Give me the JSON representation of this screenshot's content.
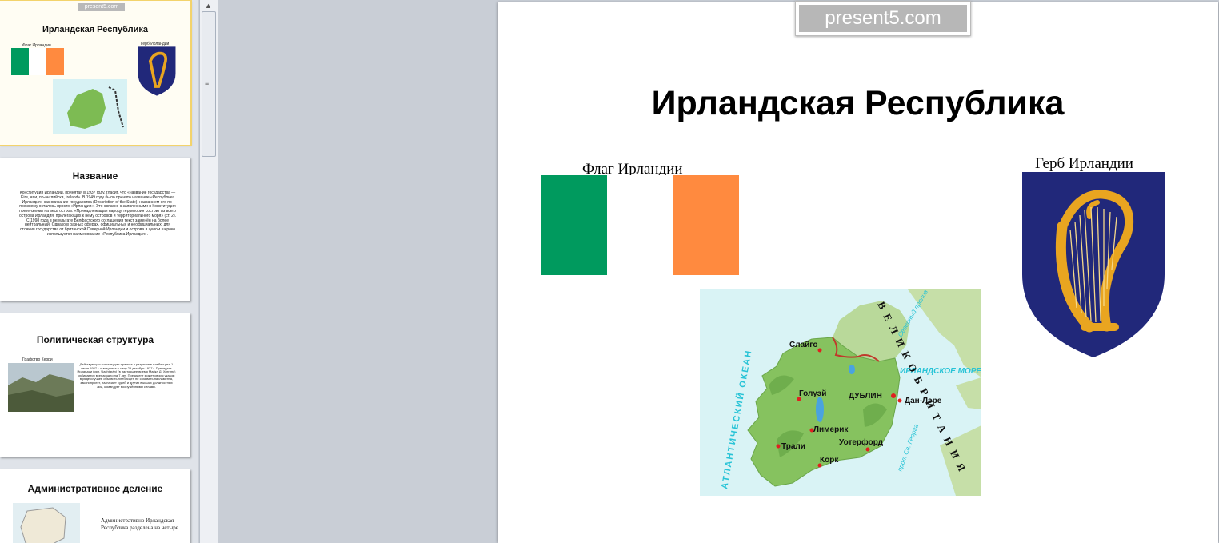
{
  "thumbnails": [
    {
      "title": "Ирландская Республика",
      "flag_caption": "Флаг Ирландии",
      "coat_caption": "Герб Ирландии",
      "watermark": "present5.com"
    },
    {
      "title": "Название",
      "body": "Конституция Ирландии, принятая в 1937 году, гласит, что «название государства — Éire, или, по-английски, Ireland». В 1949 году было принято название «Республика Ирландия» как описание государства (Description of the State), названием его по-прежнему осталось просто «Ирландия». Это связано с заявленными в Конституции претензиями на весь остров: «Принадлежащая народу территория состоит из всего острова Ирландия, прилегающих к нему островов и территориального моря» (ст. 2). С 1998 года в результате Белфастского соглашения текст заменён на более нейтральный. Однако в разных сферах, официальных и неофициальных, для отличия государства от британской Северной Ирландии и острова в целом широко используется наименование «Республика Ирландия»."
    },
    {
      "title": "Политическая структура",
      "photo_caption": "Графство Керри",
      "body": "Действующая конституция принята в результате плебисцита 1 июля 1937 г. и вступила в силу 29 декабря 1937 г. Президент Ирландии (ирл. Uachtarán) (в настоящее время Майкл Д. Хиггинс) избирается всенародно на 7 лет. Президент может своим указом в ряде случаев объявить плебисцит, не созывать парламента, законопроект, назначает судей и других высших должностных лиц, командует вооружёнными силами."
    },
    {
      "title": "Административное деление",
      "body": "Административно Ирландская Республика разделена на четыре"
    }
  ],
  "slide": {
    "watermark": "present5.com",
    "title": "Ирландская Республика",
    "flag_caption": "Флаг Ирландии",
    "coat_caption": "Герб Ирландии",
    "flag_colors": [
      "#009a5e",
      "#ffffff",
      "#ff8a3f"
    ],
    "coat_colors": {
      "shield": "#21287a",
      "harp": "#e9a520"
    },
    "map": {
      "ocean_label": "АТЛАНТИЧЕСКИЙ ОКЕАН",
      "gb_label": "ВЕЛИКОБРИТАНИЯ",
      "irish_sea_label": "ИРЛАНДСКОЕ МОРЕ",
      "north_channel_label": "Северный пролив",
      "st_george_label": "прол. Св. Георга",
      "cities": [
        "Слайго",
        "Голуэй",
        "ДУБЛИН",
        "Дан-Лэре",
        "Лимерик",
        "Трали",
        "Уотерфорд",
        "Корк"
      ]
    }
  }
}
